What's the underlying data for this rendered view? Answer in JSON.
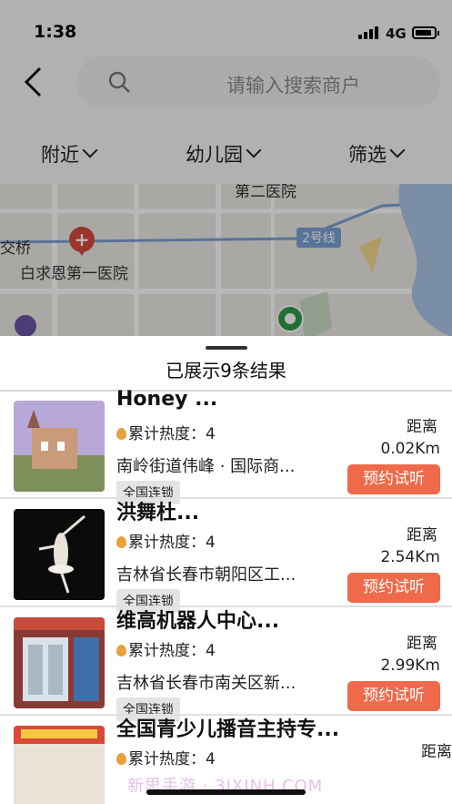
{
  "status_bar": {
    "time": "1:38",
    "network": "4G"
  },
  "search": {
    "placeholder": "请输入搜索商户"
  },
  "filters": [
    {
      "label": "附近"
    },
    {
      "label": "幼儿园"
    },
    {
      "label": "筛选"
    }
  ],
  "map": {
    "labels": [
      "第二医院",
      "交桥",
      "白求恩第一医院"
    ],
    "road_label": "2号线"
  },
  "results": {
    "summary": "已展示9条结果",
    "distance_label": "距离",
    "book_label": "预约试听",
    "heat_prefix": "累计热度：",
    "items": [
      {
        "name": "Honey  ...",
        "heat": "4",
        "address": "南岭街道伟峰 · 国际商...",
        "distance": "0.02Km",
        "tag": "全国连锁"
      },
      {
        "name": "洪舞杜...",
        "heat": "4",
        "address": "吉林省长春市朝阳区工...",
        "distance": "2.54Km",
        "tag": "全国连锁"
      },
      {
        "name": "维高机器人中心...",
        "heat": "4",
        "address": "吉林省长春市南关区新...",
        "distance": "2.99Km",
        "tag": "全国连锁"
      },
      {
        "name": "全国青少儿播音主持专...",
        "heat": "4",
        "address": "",
        "distance": "",
        "tag": ""
      }
    ]
  },
  "watermark": "新思手游 · 3JXINH.COM",
  "colors": {
    "accent_button": "#ee6a4a",
    "tag_bg": "#e4e4e4",
    "flame": "#e7a03a"
  }
}
